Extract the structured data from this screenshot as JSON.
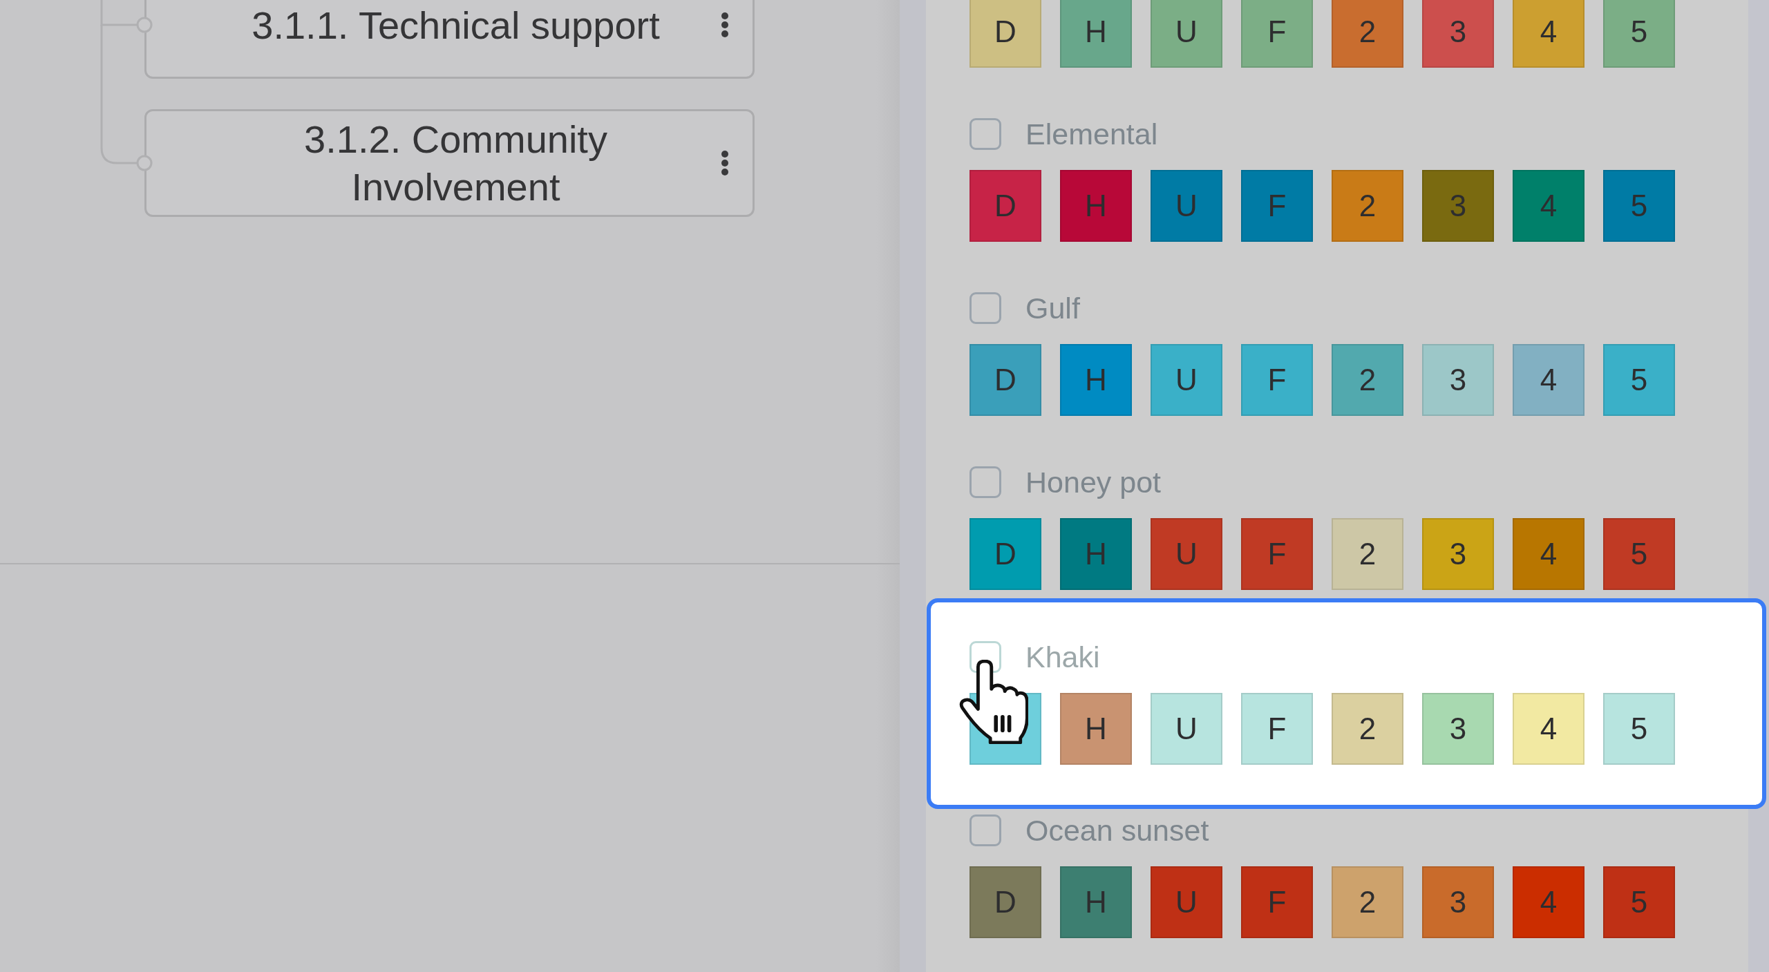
{
  "tree": {
    "nodes": [
      {
        "label": "3.1.1. Technical support"
      },
      {
        "label": "3.1.2. Community Involvement"
      }
    ]
  },
  "palettes": [
    {
      "highlighted": false,
      "swatches": [
        {
          "label": "D",
          "color": "#cdbf83"
        },
        {
          "label": "H",
          "color": "#68a78b"
        },
        {
          "label": "U",
          "color": "#7bae86"
        },
        {
          "label": "F",
          "color": "#7cae86"
        },
        {
          "label": "2",
          "color": "#c96d2f"
        },
        {
          "label": "3",
          "color": "#cc4f4d"
        },
        {
          "label": "4",
          "color": "#cc9f30"
        },
        {
          "label": "5",
          "color": "#7bae86"
        }
      ]
    },
    {
      "name": "Elemental",
      "checked": false,
      "highlighted": false,
      "swatches": [
        {
          "label": "D",
          "color": "#c72347"
        },
        {
          "label": "H",
          "color": "#b80838"
        },
        {
          "label": "U",
          "color": "#007ba5"
        },
        {
          "label": "F",
          "color": "#007ba5"
        },
        {
          "label": "2",
          "color": "#c97b17"
        },
        {
          "label": "3",
          "color": "#7a6a10"
        },
        {
          "label": "4",
          "color": "#00806a"
        },
        {
          "label": "5",
          "color": "#007ba5"
        }
      ]
    },
    {
      "name": "Gulf",
      "checked": false,
      "highlighted": false,
      "swatches": [
        {
          "label": "D",
          "color": "#3a9fba"
        },
        {
          "label": "H",
          "color": "#008bc2"
        },
        {
          "label": "U",
          "color": "#3ab0c8"
        },
        {
          "label": "F",
          "color": "#3ab0c8"
        },
        {
          "label": "2",
          "color": "#52a9ae"
        },
        {
          "label": "3",
          "color": "#9cc7c8"
        },
        {
          "label": "4",
          "color": "#82b0c2"
        },
        {
          "label": "5",
          "color": "#3ab0c8"
        }
      ]
    },
    {
      "name": "Honey pot",
      "checked": false,
      "highlighted": false,
      "swatches": [
        {
          "label": "D",
          "color": "#009caf"
        },
        {
          "label": "H",
          "color": "#007a82"
        },
        {
          "label": "U",
          "color": "#c03a24"
        },
        {
          "label": "F",
          "color": "#c03a24"
        },
        {
          "label": "2",
          "color": "#cdc7a6"
        },
        {
          "label": "3",
          "color": "#cba416"
        },
        {
          "label": "4",
          "color": "#b87600"
        },
        {
          "label": "5",
          "color": "#c03a24"
        }
      ]
    },
    {
      "name": "Khaki",
      "checked": false,
      "highlighted": true,
      "swatches": [
        {
          "color": "#6ecfdc"
        },
        {
          "label": "H",
          "color": "#c99371"
        },
        {
          "label": "U",
          "color": "#b7e4df"
        },
        {
          "label": "F",
          "color": "#b7e4df"
        },
        {
          "label": "2",
          "color": "#dbd0a0"
        },
        {
          "label": "3",
          "color": "#a8d9b0"
        },
        {
          "label": "4",
          "color": "#f2e9a2"
        },
        {
          "label": "5",
          "color": "#b7e4df"
        }
      ]
    },
    {
      "name": "Ocean sunset",
      "checked": false,
      "highlighted": false,
      "swatches": [
        {
          "label": "D",
          "color": "#7c7a5b"
        },
        {
          "label": "H",
          "color": "#3d7f71"
        },
        {
          "label": "U",
          "color": "#bf3015"
        },
        {
          "label": "F",
          "color": "#bf3015"
        },
        {
          "label": "2",
          "color": "#cda26c"
        },
        {
          "label": "3",
          "color": "#c96b2b"
        },
        {
          "label": "4",
          "color": "#cb2d00"
        },
        {
          "label": "5",
          "color": "#bf3015"
        }
      ]
    }
  ]
}
